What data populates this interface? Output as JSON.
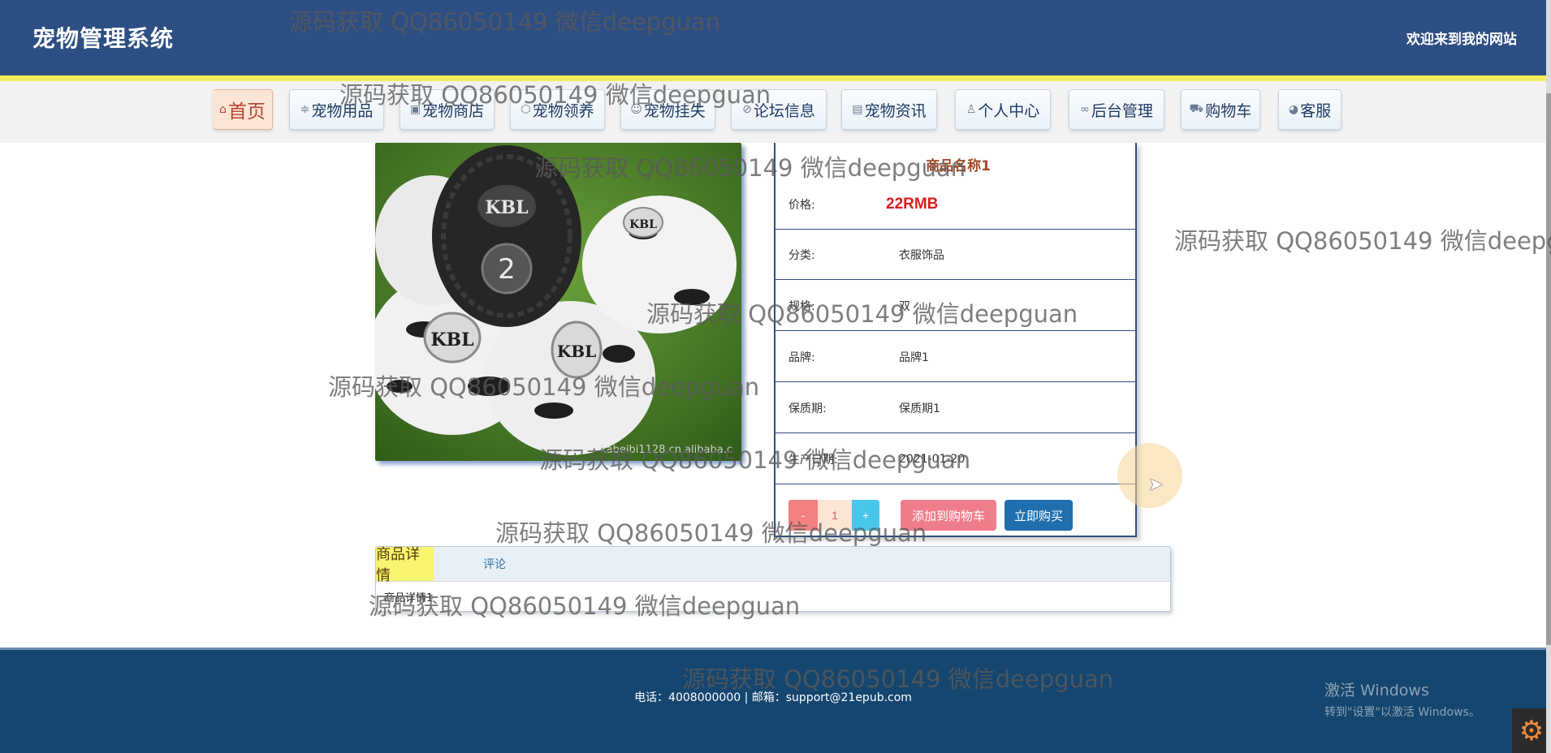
{
  "header": {
    "title": "宠物管理系统",
    "welcome": "欢迎来到我的网站"
  },
  "nav": {
    "items": [
      {
        "icon": "home-icon",
        "glyph": "⌂",
        "label": "首页"
      },
      {
        "icon": "sliders-icon",
        "glyph": "≑",
        "label": "宠物用品"
      },
      {
        "icon": "image-icon",
        "glyph": "▣",
        "label": "宠物商店"
      },
      {
        "icon": "box-icon",
        "glyph": "⬡",
        "label": "宠物领养"
      },
      {
        "icon": "smile-icon",
        "glyph": "☺",
        "label": "宠物挂失"
      },
      {
        "icon": "tag-icon",
        "glyph": "⊘",
        "label": "论坛信息"
      },
      {
        "icon": "newspaper-icon",
        "glyph": "▤",
        "label": "宠物资讯"
      },
      {
        "icon": "user-icon",
        "glyph": "♙",
        "label": "个人中心"
      },
      {
        "icon": "link-icon",
        "glyph": "∞",
        "label": "后台管理"
      },
      {
        "icon": "cart-icon",
        "glyph": "⛟",
        "label": "购物车"
      },
      {
        "icon": "help-icon",
        "glyph": "◕",
        "label": "客服"
      }
    ]
  },
  "product": {
    "name": "商品名称1",
    "image_caption": "kabeibi1128.cn.alibaba.c",
    "fields": [
      {
        "label": "价格:",
        "value": "22RMB"
      },
      {
        "label": "分类:",
        "value": "衣服饰品"
      },
      {
        "label": "规格:",
        "value": "双"
      },
      {
        "label": "品牌:",
        "value": "品牌1"
      },
      {
        "label": "保质期:",
        "value": "保质期1"
      },
      {
        "label": "生产日期:",
        "value": "2021-01-20"
      }
    ],
    "quantity": {
      "minus": "-",
      "value": "1",
      "plus": "+"
    },
    "add_to_cart": "添加到购物车",
    "buy_now": "立即购买"
  },
  "tabs": {
    "items": [
      "商品详情",
      "评论"
    ],
    "active": "商品详情",
    "content": "商品详情1"
  },
  "footer": {
    "text": "电话：4008000000 | 邮箱：support@21epub.com"
  },
  "windows": {
    "line1": "激活 Windows",
    "line2": "转到\"设置\"以激活 Windows。"
  },
  "watermark": "源码获取 QQ86050149 微信deepguan",
  "colors": {
    "header": "#2d4f84",
    "footer": "#15466f",
    "price": "#d81e1e",
    "add_to_cart": "#f07d8b",
    "buy_now": "#1f6fae",
    "active_tab": "#f8f571"
  }
}
